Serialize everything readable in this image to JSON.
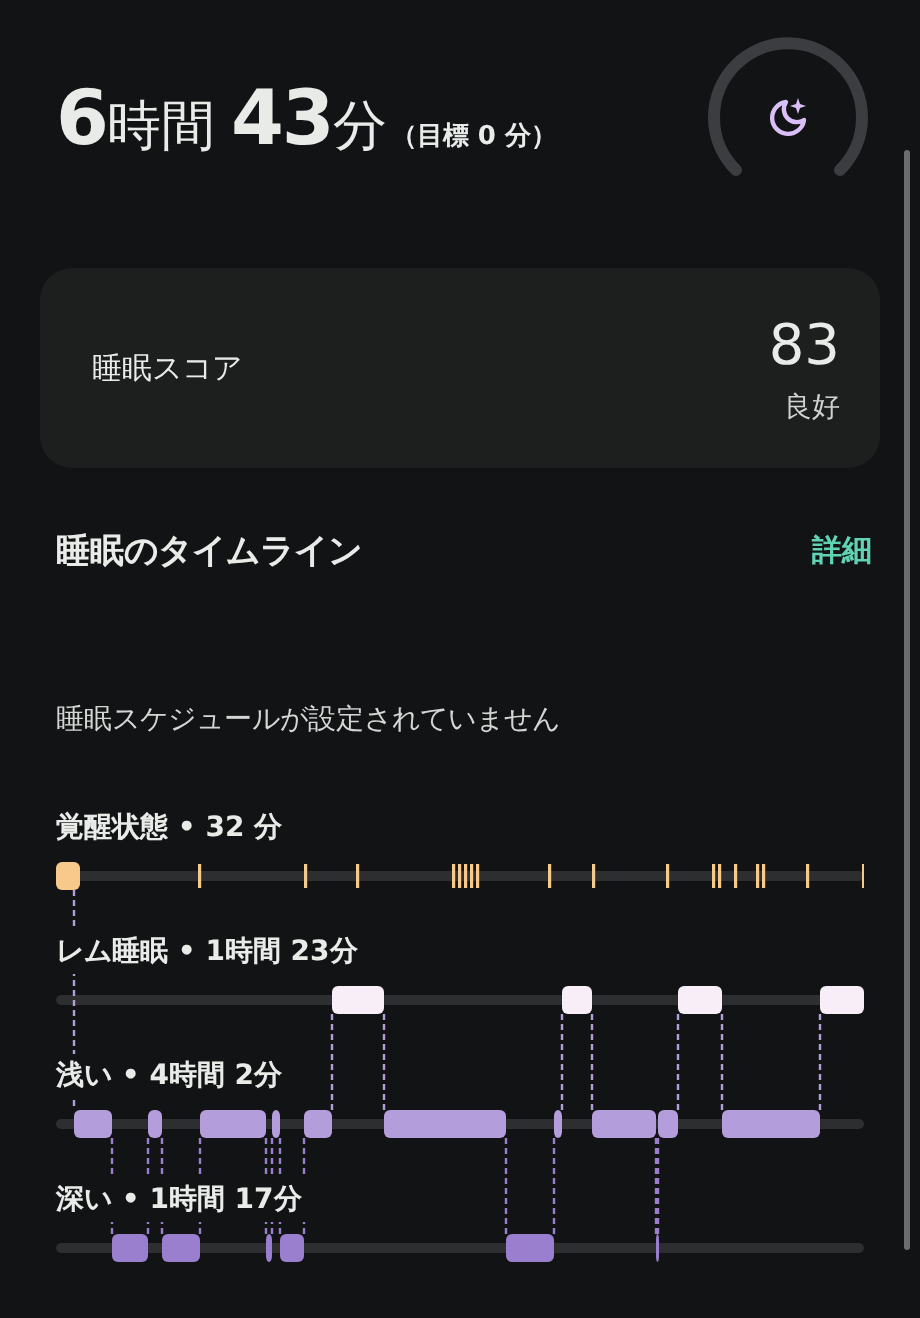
{
  "summary": {
    "hours": "6",
    "hours_unit": "時間",
    "minutes": "43",
    "minutes_unit": "分",
    "goal": "（目標 0 分）"
  },
  "score_card": {
    "label": "睡眠スコア",
    "score": "83",
    "rating": "良好"
  },
  "timeline": {
    "title": "睡眠のタイムライン",
    "details_link": "詳細",
    "schedule_note": "睡眠スケジュールが設定されていません",
    "stages": [
      {
        "label": "覚醒状態 • 32 分"
      },
      {
        "label": "レム睡眠 • 1時間 23分"
      },
      {
        "label": "浅い • 4時間 2分"
      },
      {
        "label": "深い • 1時間 17分"
      }
    ]
  }
}
